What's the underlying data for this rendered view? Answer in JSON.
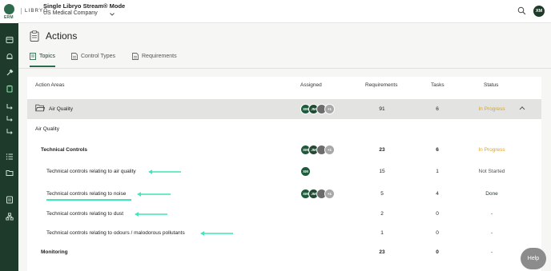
{
  "app": {
    "logo_text": "ERM",
    "brand": "LIBRYO",
    "mode_title": "Single Libryo Stream® Mode",
    "company": "US Medical Company",
    "user_initials": "XM"
  },
  "page": {
    "title": "Actions",
    "tabs": [
      {
        "label": "Topics",
        "active": true
      },
      {
        "label": "Control Types",
        "active": false
      },
      {
        "label": "Requirements",
        "active": false
      }
    ]
  },
  "table": {
    "headers": {
      "action_areas": "Action Areas",
      "assigned": "Assigned",
      "requirements": "Requirements",
      "tasks": "Tasks",
      "status": "Status"
    },
    "group": {
      "name": "Air Quality",
      "requirements": "91",
      "tasks": "6",
      "status": "In Progress",
      "avatars": [
        "XM",
        "JM",
        "",
        "+1"
      ]
    },
    "section_label": "Air Quality",
    "rows": [
      {
        "label": "Technical Controls",
        "requirements": "23",
        "tasks": "6",
        "status": "In Progress",
        "avatars": [
          "XM",
          "JM",
          "",
          "+1"
        ]
      },
      {
        "label": "Technical controls relating to air quality",
        "requirements": "15",
        "tasks": "1",
        "status": "Not Started",
        "avatars": [
          "XM"
        ]
      },
      {
        "label": "Technical controls relating to noise",
        "requirements": "5",
        "tasks": "4",
        "status": "Done",
        "avatars": [
          "XM",
          "JM",
          "",
          "+1"
        ]
      },
      {
        "label": "Technical controls relating to dust",
        "requirements": "2",
        "tasks": "0",
        "status": "-"
      },
      {
        "label": "Technical controls relating to odours / malodorous pollutants",
        "requirements": "1",
        "tasks": "0",
        "status": "-"
      },
      {
        "label": "Monitoring",
        "requirements": "23",
        "tasks": "0",
        "status": "-"
      }
    ]
  },
  "help": {
    "label": "Help"
  },
  "colors": {
    "rail": "#1d3a2b",
    "accent": "#2e6b4e",
    "in_progress": "#e2a413",
    "arrow": "#3ee6b8"
  }
}
